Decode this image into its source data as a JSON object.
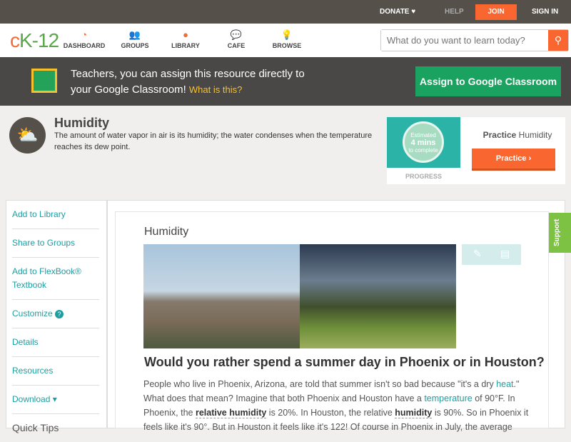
{
  "topbar": {
    "donate": "DONATE ♥",
    "help": "HELP",
    "join": "JOIN",
    "signin": "SIGN IN"
  },
  "logo": {
    "a": "c",
    "b": "K-12"
  },
  "nav": [
    {
      "label": "DASHBOARD",
      "icon": "◔"
    },
    {
      "label": "GROUPS",
      "icon": "👥"
    },
    {
      "label": "LIBRARY",
      "icon": "●"
    },
    {
      "label": "CAFE",
      "icon": "💬"
    },
    {
      "label": "BROWSE",
      "icon": "💡"
    }
  ],
  "search": {
    "placeholder": "What do you want to learn today?",
    "icon": "⚲"
  },
  "classroom": {
    "line1": "Teachers, you can assign this resource directly to",
    "line2": "your Google Classroom!",
    "link": "What is this?",
    "button": "Assign to Google Classroom"
  },
  "concept": {
    "icon": "⛅",
    "title": "Humidity",
    "description": "The amount of water vapor in air is its humidity; the water condenses when the temperature reaches its dew point."
  },
  "practice": {
    "est1": "Estimated",
    "est2": "4 mins",
    "est3": "to complete",
    "progress": "PROGRESS",
    "title_bold": "Practice",
    "title_rest": "Humidity",
    "button": "Practice ›"
  },
  "sidebar": [
    "Add to Library",
    "Share to Groups",
    "Add to FlexBook® Textbook",
    "Customize",
    "Details",
    "Resources",
    "Download ▾"
  ],
  "sidebar_help": "?",
  "quick_tips": "Quick Tips",
  "support": "Support",
  "main": {
    "title": "Humidity",
    "question": "Would you rather spend a summer day in Phoenix or in Houston?",
    "p1": "People who live in Phoenix, Arizona, are told that summer isn't so bad because \"it's a dry ",
    "heat": "heat",
    "p2": ".\" What does that mean? Imagine that both Phoenix and Houston have a ",
    "temperature": "temperature",
    "p3": " of 90°F. In Phoenix, the ",
    "rh": "relative humidity",
    "p4": " is 20%. In Houston, the relative ",
    "hum": "humidity",
    "p5": " is 90%. So in Phoenix it feels like it's 90°. But in Houston it feels like it's 122! Of course in Phoenix in July, the average"
  }
}
